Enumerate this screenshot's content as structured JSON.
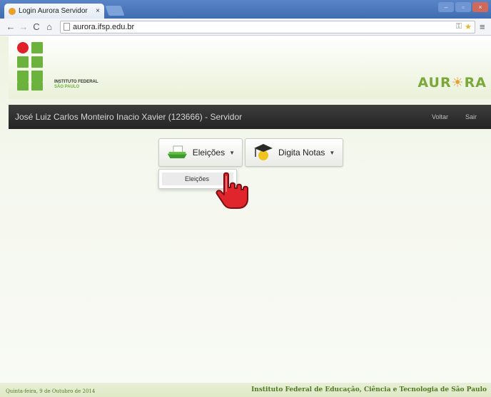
{
  "browser": {
    "tab_title": "Login Aurora Servidor",
    "tab_close": "×",
    "url": "aurora.ifsp.edu.br",
    "window_controls": [
      "–",
      "▫",
      "×"
    ]
  },
  "header": {
    "institute_line1": "INSTITUTO FEDERAL",
    "institute_line2": "SÃO PAULO",
    "app_logo_left": "AUR",
    "app_logo_sun": "☀",
    "app_logo_right": "RA"
  },
  "userbar": {
    "user_label": "José Luiz Carlos Monteiro Inacio Xavier (123666) - Servidor",
    "back_link": "Voltar",
    "exit_link": "Sair"
  },
  "menus": {
    "elections_label": "Eleições",
    "grades_label": "Digita Notas",
    "dropdown_item": "Eleições"
  },
  "footer": {
    "date": "Quinta-feira, 9 de Outubro de 2014",
    "institution": "Instituto Federal de Educação, Ciência e Tecnologia de São Paulo"
  },
  "icons": {
    "favicon": "aurora-favicon-icon",
    "ballot": "ballot-box-icon",
    "graduate": "graduation-cap-icon",
    "cursor": "hand-pointer-icon"
  },
  "colors": {
    "brand_green": "#6cb33e",
    "logo_red": "#e0202a",
    "userbar_bg": "#2f2f2f",
    "footer_text": "#4f7a23"
  }
}
